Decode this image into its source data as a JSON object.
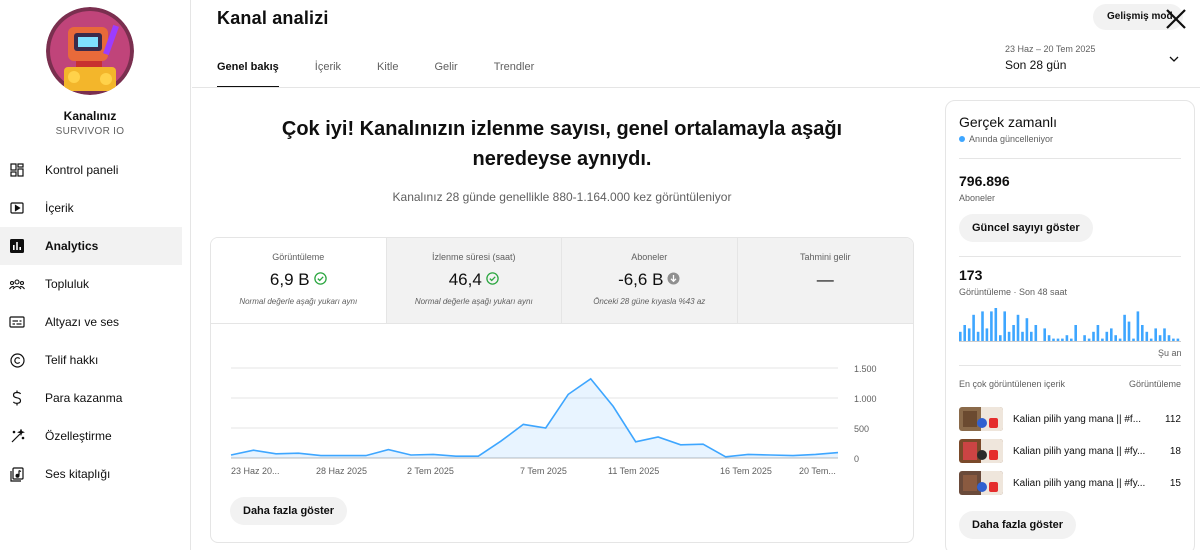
{
  "channel": {
    "name": "Kanalınız",
    "subtitle": "SURVIVOR IO"
  },
  "sidebar": {
    "items": [
      {
        "label": "Kontrol paneli",
        "icon": "dashboard-icon"
      },
      {
        "label": "İçerik",
        "icon": "content-icon"
      },
      {
        "label": "Analytics",
        "icon": "analytics-icon",
        "active": true
      },
      {
        "label": "Topluluk",
        "icon": "community-icon"
      },
      {
        "label": "Altyazı ve ses",
        "icon": "subtitles-icon"
      },
      {
        "label": "Telif hakkı",
        "icon": "copyright-icon"
      },
      {
        "label": "Para kazanma",
        "icon": "dollar-icon"
      },
      {
        "label": "Özelleştirme",
        "icon": "magic-wand-icon"
      },
      {
        "label": "Ses kitaplığı",
        "icon": "audio-library-icon"
      }
    ]
  },
  "header": {
    "title": "Kanal analizi",
    "advanced_label": "Gelişmiş mod",
    "tabs": [
      "Genel bakış",
      "İçerik",
      "Kitle",
      "Gelir",
      "Trendler"
    ],
    "date_range": "23 Haz – 20 Tem 2025",
    "date_label": "Son 28 gün"
  },
  "main": {
    "headline": "Çok iyi! Kanalınızın izlenme sayısı, genel ortalamayla aşağı neredeyse aynıydı.",
    "subtext": "Kanalınız 28 günde genellikle 880-1.164.000 kez görüntüleniyor",
    "metrics": [
      {
        "title": "Görüntüleme",
        "value": "6,9 B",
        "status": "check",
        "note": "Normal değerle aşağı yukarı aynı"
      },
      {
        "title": "İzlenme süresi (saat)",
        "value": "46,4",
        "status": "check",
        "note": "Normal değerle aşağı yukarı aynı"
      },
      {
        "title": "Aboneler",
        "value": "-6,6 B",
        "status": "down",
        "note": "Önceki 28 güne kıyasla %43 az"
      },
      {
        "title": "Tahmini gelir",
        "value": "—",
        "status": "none",
        "note": ""
      }
    ],
    "more_label": "Daha fazla göster"
  },
  "chart_data": {
    "type": "area",
    "x_tick_labels": [
      "23 Haz 20...",
      "28 Haz 2025",
      "2 Tem 2025",
      "7 Tem 2025",
      "11 Tem 2025",
      "16 Tem 2025",
      "20 Tem..."
    ],
    "y_tick_labels": [
      "1.500",
      "1.000",
      "500",
      "0"
    ],
    "ylim": [
      0,
      1500
    ],
    "values": [
      50,
      130,
      70,
      80,
      40,
      40,
      40,
      140,
      50,
      60,
      30,
      30,
      280,
      560,
      500,
      1060,
      1320,
      860,
      270,
      350,
      220,
      230,
      20,
      60,
      50,
      40,
      60,
      90
    ],
    "accent": "#3ea6ff"
  },
  "realtime": {
    "title": "Gerçek zamanlı",
    "live_label": "Anında güncelleniyor",
    "subscribers_value": "796.896",
    "subscribers_label": "Aboneler",
    "show_count_label": "Güncel sayıyı göster",
    "views_value": "173",
    "views_label": "Görüntüleme · Son 48 saat",
    "now_label": "Şu an",
    "bars": [
      3,
      5,
      4,
      8,
      3,
      9,
      4,
      9,
      10,
      2,
      9,
      3,
      5,
      8,
      3,
      7,
      3,
      5,
      0,
      4,
      2,
      1,
      1,
      1,
      2,
      1,
      5,
      0,
      2,
      1,
      3,
      5,
      1,
      3,
      4,
      2,
      1,
      8,
      6,
      1,
      9,
      5,
      3,
      1,
      4,
      2,
      4,
      2,
      1,
      1
    ],
    "top_content_label": "En çok görüntülenen içerik",
    "top_views_label": "Görüntüleme",
    "top_content": [
      {
        "title": "Kalian pilih yang mana || #f...",
        "views": "112"
      },
      {
        "title": "Kalian pilih yang mana || #fy...",
        "views": "18"
      },
      {
        "title": "Kalian pilih yang mana || #fy...",
        "views": "15"
      }
    ],
    "more_label": "Daha fazla göster"
  }
}
